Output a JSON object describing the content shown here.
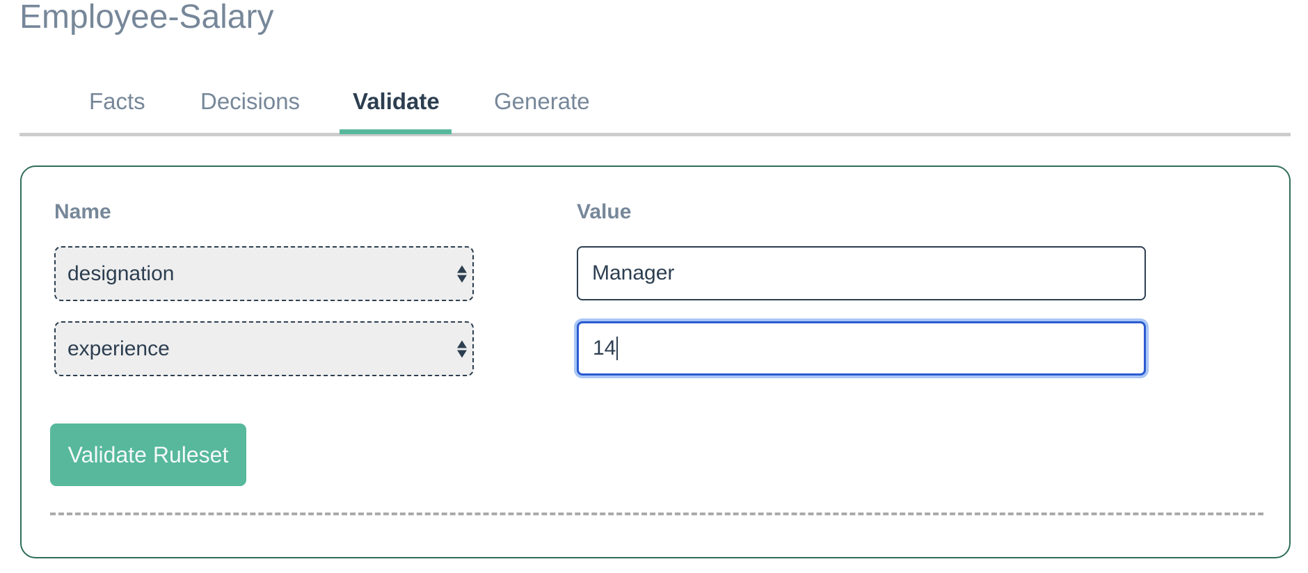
{
  "page": {
    "title": "Employee-Salary"
  },
  "tabs": [
    {
      "label": "Facts",
      "active": false
    },
    {
      "label": "Decisions",
      "active": false
    },
    {
      "label": "Validate",
      "active": true
    },
    {
      "label": "Generate",
      "active": false
    }
  ],
  "form": {
    "name_header": "Name",
    "value_header": "Value",
    "rows": [
      {
        "name": "designation",
        "value": "Manager"
      },
      {
        "name": "experience",
        "value": "14"
      }
    ],
    "validate_button": "Validate Ruleset"
  },
  "colors": {
    "accent": "#57b89b",
    "card_border": "#2e6e58",
    "text_dark": "#2c3e50",
    "text_muted": "#768799",
    "focus_ring": "#2a5bd0"
  }
}
